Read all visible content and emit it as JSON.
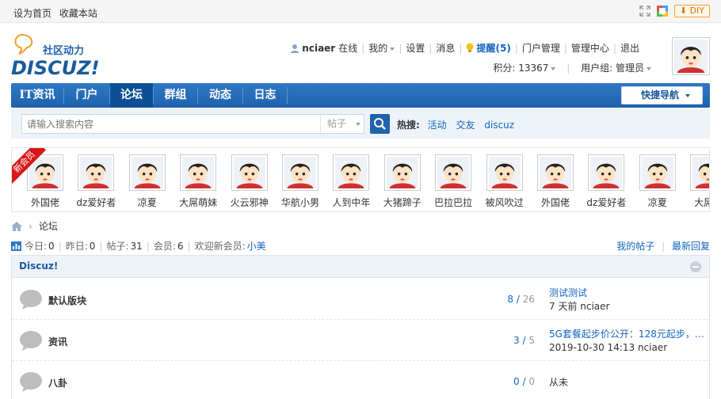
{
  "topbar": {
    "links": [
      "设为首页",
      "收藏本站"
    ],
    "diy_label": "DIY"
  },
  "header": {
    "logo_text_cn": "社区动力",
    "logo_text_en": "DISCUZ!",
    "username": "nciaer",
    "status": "在线",
    "my_label": "我的",
    "settings_label": "设置",
    "messages_label": "消息",
    "remind_label": "提醒(5)",
    "portal_admin_label": "门户管理",
    "admin_center_label": "管理中心",
    "logout_label": "退出",
    "credits_label": "积分: 13367",
    "usergroup_label": "用户组: 管理员"
  },
  "nav": {
    "items": [
      {
        "label": "IT资讯",
        "active": false
      },
      {
        "label": "门户",
        "active": false
      },
      {
        "label": "论坛",
        "active": true
      },
      {
        "label": "群组",
        "active": false
      },
      {
        "label": "动态",
        "active": false
      },
      {
        "label": "日志",
        "active": false
      }
    ],
    "quick_nav_label": "快捷导航"
  },
  "search": {
    "placeholder": "请输入搜索内容",
    "type_label": "帖子",
    "hot_label": "热搜:",
    "hot_tags": [
      "活动",
      "交友",
      "discuz"
    ]
  },
  "new_members": {
    "ribbon_label": "新会员",
    "members": [
      "外国佬",
      "dz爱好者",
      "凉夏",
      "大屌萌妹",
      "火云邪神",
      "华航小男",
      "人到中年",
      "大猪蹄子",
      "巴拉巴拉",
      "被风吹过",
      "外国佬",
      "dz爱好者",
      "凉夏",
      "大屌萌"
    ]
  },
  "breadcrumb": {
    "current": "论坛"
  },
  "stats": {
    "today_label": "今日:",
    "today_value": "0",
    "yesterday_label": "昨日:",
    "yesterday_value": "0",
    "posts_label": "帖子:",
    "posts_value": "31",
    "members_label": "会员:",
    "members_value": "6",
    "welcome_label": "欢迎新会员:",
    "newest_member": "小美",
    "my_posts_label": "我的帖子",
    "latest_reply_label": "最新回复"
  },
  "group": {
    "title": "Discuz!",
    "forums": [
      {
        "name": "默认版块",
        "threads": "8",
        "posts": "26",
        "last_title": "测试测试",
        "last_meta": "7 天前 nciaer"
      },
      {
        "name": "资讯",
        "threads": "3",
        "posts": "5",
        "last_title": "5G套餐起步价公开：128元起步，…",
        "last_meta": "2019-10-30 14:13 nciaer"
      },
      {
        "name": "八卦",
        "threads": "0",
        "posts": "0",
        "last_title": "",
        "last_meta": "从未"
      }
    ]
  },
  "colors": {
    "nav_blue": "#1f62ad",
    "link_blue": "#1565c0",
    "ribbon_red": "#d71818"
  }
}
